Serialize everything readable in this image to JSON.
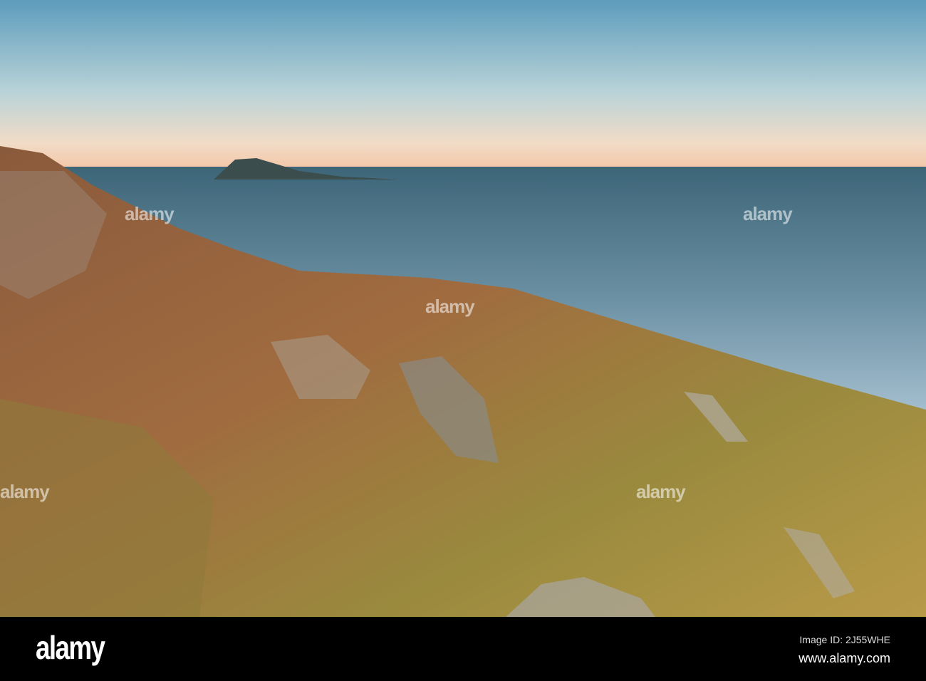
{
  "watermark": {
    "text": "alamy"
  },
  "footer": {
    "logo": "alamy",
    "image_id": "Image ID: 2J55WHE",
    "website": "www.alamy.com"
  }
}
